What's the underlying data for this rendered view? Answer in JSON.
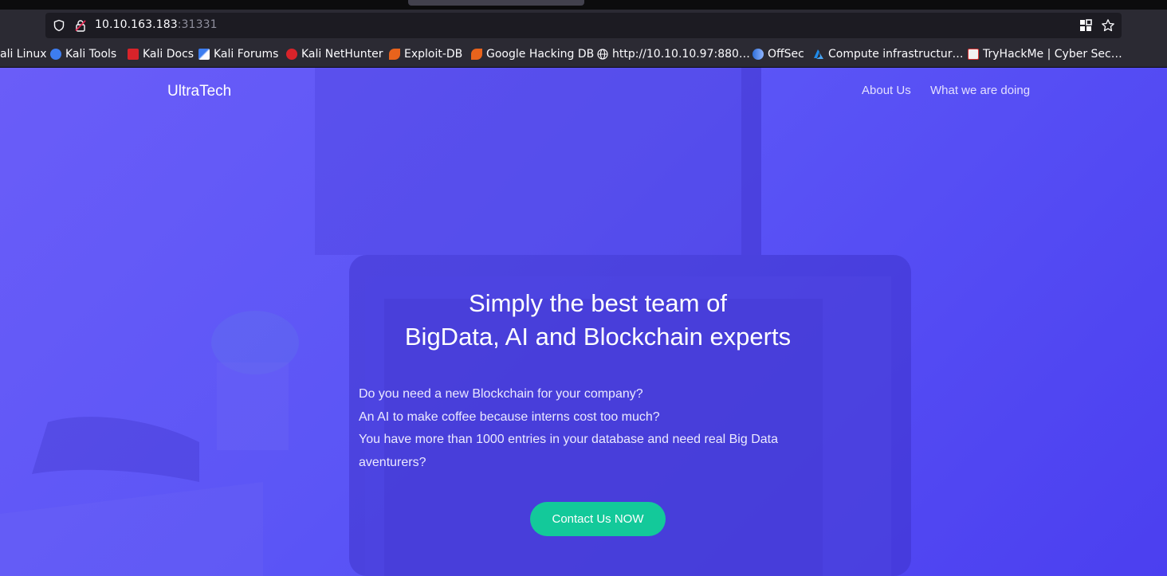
{
  "browser": {
    "url_host": "10.10.163.183",
    "url_port": ":31331",
    "bookmarks": [
      {
        "label": "ali Linux",
        "icon": "kali-icon"
      },
      {
        "label": "Kali Tools",
        "icon": "kali-tools-icon"
      },
      {
        "label": "Kali Docs",
        "icon": "kali-docs-icon"
      },
      {
        "label": "Kali Forums",
        "icon": "kali-forums-icon"
      },
      {
        "label": "Kali NetHunter",
        "icon": "kali-nethunter-icon"
      },
      {
        "label": "Exploit-DB",
        "icon": "exploit-db-icon"
      },
      {
        "label": "Google Hacking DB",
        "icon": "ghdb-icon"
      },
      {
        "label": "http://10.10.10.97:880…",
        "icon": "globe-icon"
      },
      {
        "label": "OffSec",
        "icon": "offsec-icon"
      },
      {
        "label": "Compute infrastructur…",
        "icon": "azure-icon"
      },
      {
        "label": "TryHackMe | Cyber Sec…",
        "icon": "tryhackme-icon"
      }
    ]
  },
  "site": {
    "brand": "UltraTech",
    "nav": [
      {
        "label": "About Us"
      },
      {
        "label": "What we are doing"
      }
    ],
    "hero": {
      "title_line1": "Simply the best team of",
      "title_line2": "BigData, AI and Blockchain experts",
      "copy_line1": "Do you need a new Blockchain for your company?",
      "copy_line2": "An AI to make coffee because interns cost too much?",
      "copy_line3": "You have more than 1000 entries in your database and need real Big Data aventurers?",
      "cta_label": "Contact Us NOW"
    }
  },
  "colors": {
    "accent": "#13c99a",
    "hero_bg": "#5b55f6"
  }
}
